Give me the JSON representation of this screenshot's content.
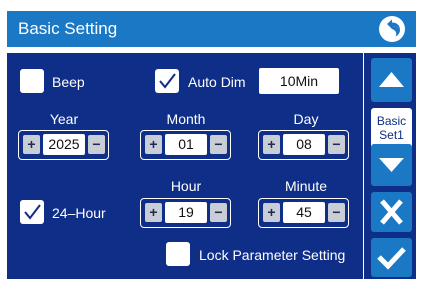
{
  "header": {
    "title": "Basic Setting",
    "back_icon": "undo-arrow-icon"
  },
  "options": {
    "beep": {
      "label": "Beep",
      "checked": false
    },
    "auto_dim": {
      "label": "Auto Dim",
      "checked": true,
      "value": "10Min"
    },
    "hour24": {
      "label": "24–Hour",
      "checked": true
    },
    "lock": {
      "label": "Lock Parameter Setting",
      "checked": false
    }
  },
  "date": {
    "year": {
      "label": "Year",
      "value": "2025"
    },
    "month": {
      "label": "Month",
      "value": "01"
    },
    "day": {
      "label": "Day",
      "value": "08"
    }
  },
  "time": {
    "hour": {
      "label": "Hour",
      "value": "19"
    },
    "minute": {
      "label": "Minute",
      "value": "45"
    }
  },
  "stepper": {
    "plus": "+",
    "minus": "−"
  },
  "side": {
    "page_label_line1": "Basic",
    "page_label_line2": "Set1"
  },
  "colors": {
    "header": "#1b78c4",
    "panel": "#0f2e88",
    "button": "#1b78c4"
  }
}
